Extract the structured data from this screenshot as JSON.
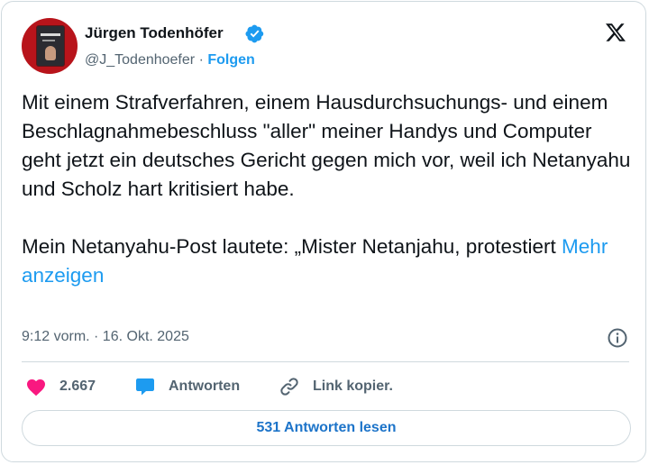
{
  "author": {
    "name": "Jürgen Todenhöfer",
    "handle": "@J_Todenhoefer",
    "separator": "·",
    "follow_label": "Folgen",
    "verified": true
  },
  "tweet": {
    "text": "Mit einem Strafverfahren, einem Hausdurchsuchungs- und einem Beschlagnahmebeschluss \"aller\" meiner Handys und Computer geht jetzt ein deutsches Gericht gegen mich vor, weil ich Netanyahu und Scholz hart kritisiert habe.\n\nMein Netanyahu-Post lautete: „Mister Netanjahu, protestiert ",
    "more_label": "Mehr anzeigen",
    "timestamp": "9:12 vorm. · 16. Okt. 2025"
  },
  "actions": {
    "like_count": "2.667",
    "reply_label": "Antworten",
    "copy_link_label": "Link kopier."
  },
  "read_replies_label": "531 Antworten lesen",
  "colors": {
    "accent": "#1d9bf0",
    "like": "#f91880",
    "muted": "#536471"
  },
  "icons": [
    "x-logo-icon",
    "verified-badge-icon",
    "info-icon",
    "heart-icon",
    "reply-bubble-icon",
    "link-icon"
  ]
}
